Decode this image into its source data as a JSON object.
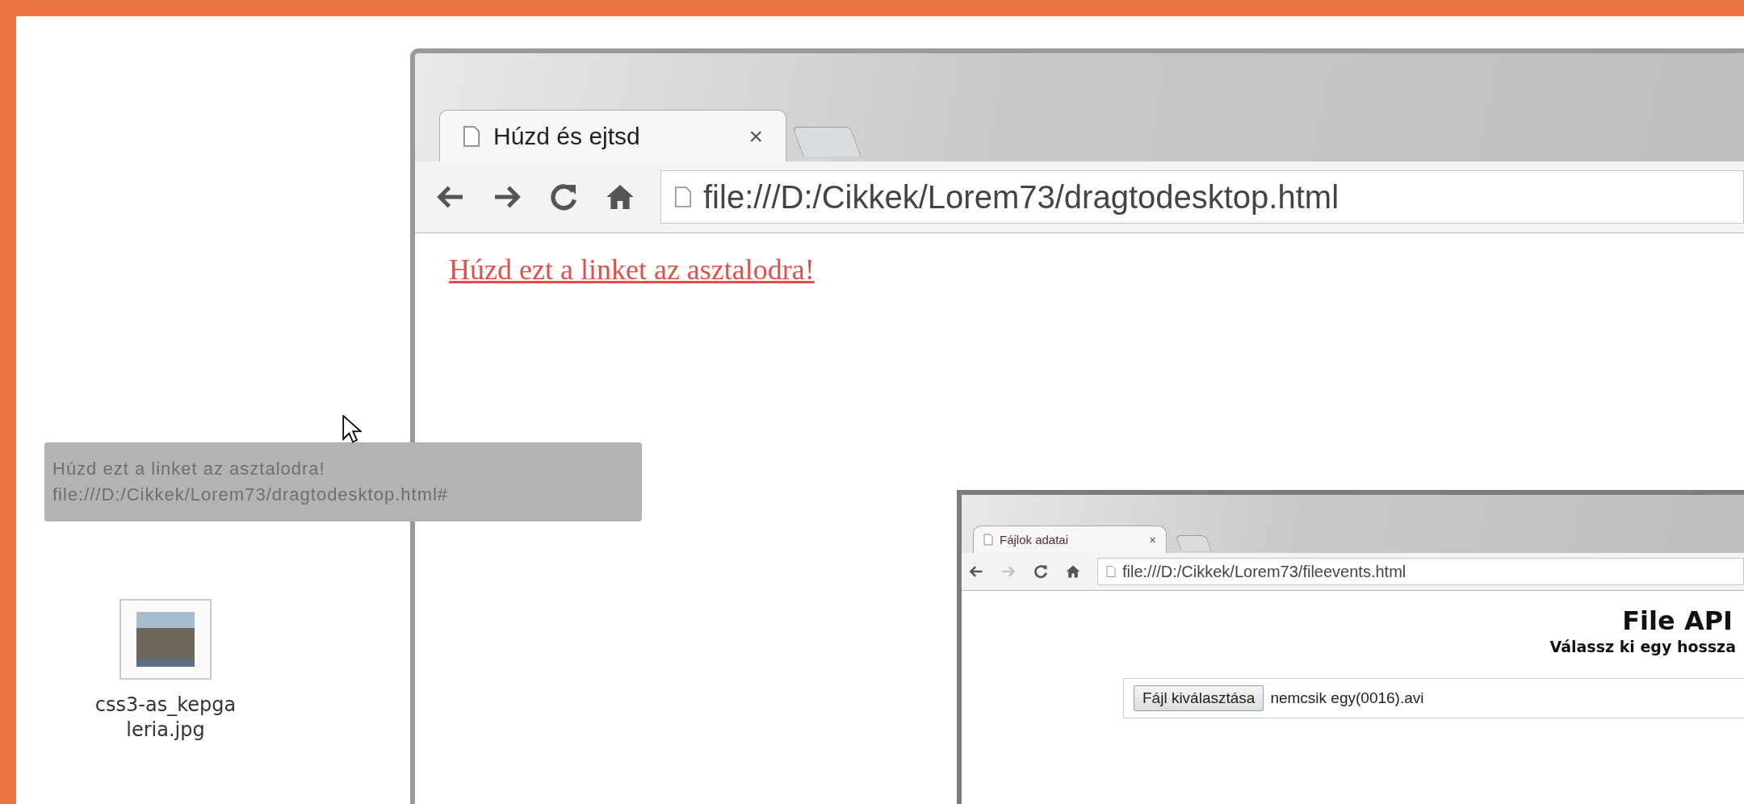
{
  "desktop": {
    "icons": [
      {
        "label_lines": [
          "css3-as_kepga",
          "leria.jpg"
        ]
      }
    ],
    "drag_ghost": {
      "lines": [
        "Húzd ezt a linket az asztalodra!",
        "file:///D:/Cikkek/Lorem73/dragtodesktop.html#"
      ]
    }
  },
  "windows": [
    {
      "kind": "large",
      "tabs": [
        {
          "title": "Húzd és ejtsd",
          "close": "×",
          "selected": true
        }
      ],
      "nav": [
        {
          "kind": "back",
          "disabled": false
        },
        {
          "kind": "forward",
          "disabled": false
        },
        {
          "kind": "reload",
          "disabled": false
        },
        {
          "kind": "home",
          "disabled": false
        }
      ],
      "url": "file:///D:/Cikkek/Lorem73/dragtodesktop.html",
      "page": {
        "kind": "link",
        "text": "Húzd ezt a linket az asztalodra!"
      }
    },
    {
      "kind": "small",
      "tabs": [
        {
          "title": "Fájlok adatai",
          "close": "×",
          "selected": true
        }
      ],
      "nav": [
        {
          "kind": "back",
          "disabled": false
        },
        {
          "kind": "forward",
          "disabled": true
        },
        {
          "kind": "reload",
          "disabled": false
        },
        {
          "kind": "home",
          "disabled": false
        }
      ],
      "url": "file:///D:/Cikkek/Lorem73/fileevents.html",
      "page": {
        "kind": "file_form",
        "heading": "File API",
        "subheading": "Válassz ki egy hossza",
        "file_button": "Fájl kiválasztása",
        "file_name": "nemcsik egy(0016).avi"
      }
    }
  ]
}
